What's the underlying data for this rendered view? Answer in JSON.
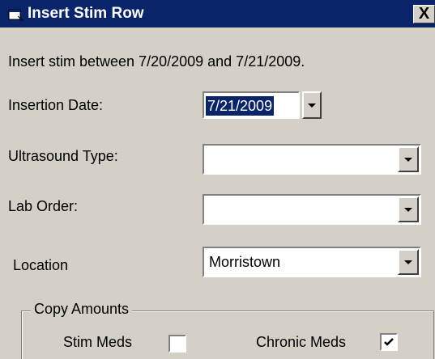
{
  "window": {
    "title": "Insert Stim Row",
    "close_label": "X"
  },
  "info_text": "Insert stim between 7/20/2009 and 7/21/2009.",
  "insertion_date": {
    "label": "Insertion Date:",
    "value": "7/21/2009"
  },
  "ultrasound_type": {
    "label": "Ultrasound Type:",
    "value": ""
  },
  "lab_order": {
    "label": "Lab Order:",
    "value": ""
  },
  "location": {
    "label": "Location",
    "value": "Morristown"
  },
  "copy_amounts": {
    "title": "Copy Amounts",
    "stim_meds": {
      "label": "Stim Meds",
      "checked": false
    },
    "chronic_meds": {
      "label": "Chronic Meds",
      "checked": true
    }
  },
  "icons": {
    "title_icon": "window-app-icon",
    "dropdown": "chevron-down-icon",
    "check": "checkmark-icon"
  },
  "colors": {
    "titlebar": "#0a246a",
    "face": "#d4d0c8",
    "selection": "#0a246a"
  }
}
